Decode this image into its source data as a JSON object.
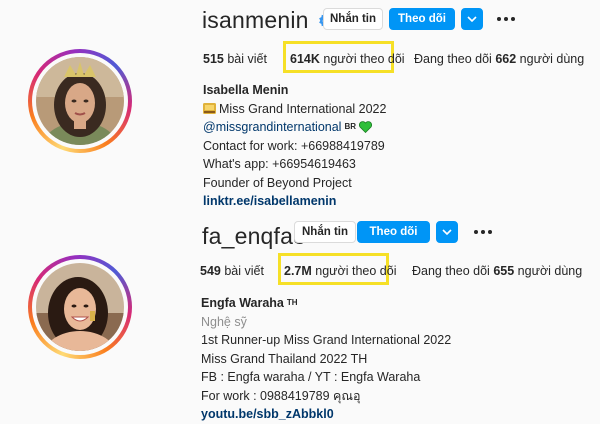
{
  "profiles": [
    {
      "username": "isanmenin",
      "verified": true,
      "message_label": "Nhắn tin",
      "follow_label": "Theo dõi",
      "posts_count": "515",
      "posts_label": "bài viết",
      "followers_count": "614K",
      "followers_label": "người theo dõi",
      "following_prefix": "Đang theo dõi",
      "following_count": "662",
      "following_label": "người dùng",
      "name": "Isabella Menin",
      "bio_title": "Miss Grand International 2022",
      "bio_mention": "@missgrandinternational",
      "bio_mention_suffix": "BR",
      "bio_lines": [
        "Contact for work: +66988419789",
        "What's app: +66954619463",
        "Founder of Beyond Project"
      ],
      "link": "linktr.ee/isabellamenin"
    },
    {
      "username": "fa_enqfa8",
      "verified": false,
      "message_label": "Nhắn tin",
      "follow_label": "Theo dõi",
      "posts_count": "549",
      "posts_label": "bài viết",
      "followers_count": "2.7M",
      "followers_label": "người theo dõi",
      "following_prefix": "Đang theo dõi",
      "following_count": "655",
      "following_label": "người dùng",
      "name": "Engfa Waraha",
      "name_suffix": "TH",
      "category": "Nghệ sỹ",
      "bio_lines": [
        "1st Runner-up Miss Grand International 2022",
        "Miss Grand Thailand 2022 TH",
        "FB : Engfa waraha / YT : Engfa Waraha",
        "For work : 0988419789 คุณอุ"
      ],
      "link": "youtu.be/sbb_zAbbkl0"
    }
  ],
  "icons": [
    "verified-badge-icon",
    "chevron-down-icon",
    "more-options-icon",
    "trophy-emoji-icon",
    "green-heart-emoji-icon"
  ],
  "colors": {
    "follow_button": "#0095f6",
    "highlight_box": "#f6e027",
    "link": "#00376b",
    "muted": "#8e8e8e"
  }
}
